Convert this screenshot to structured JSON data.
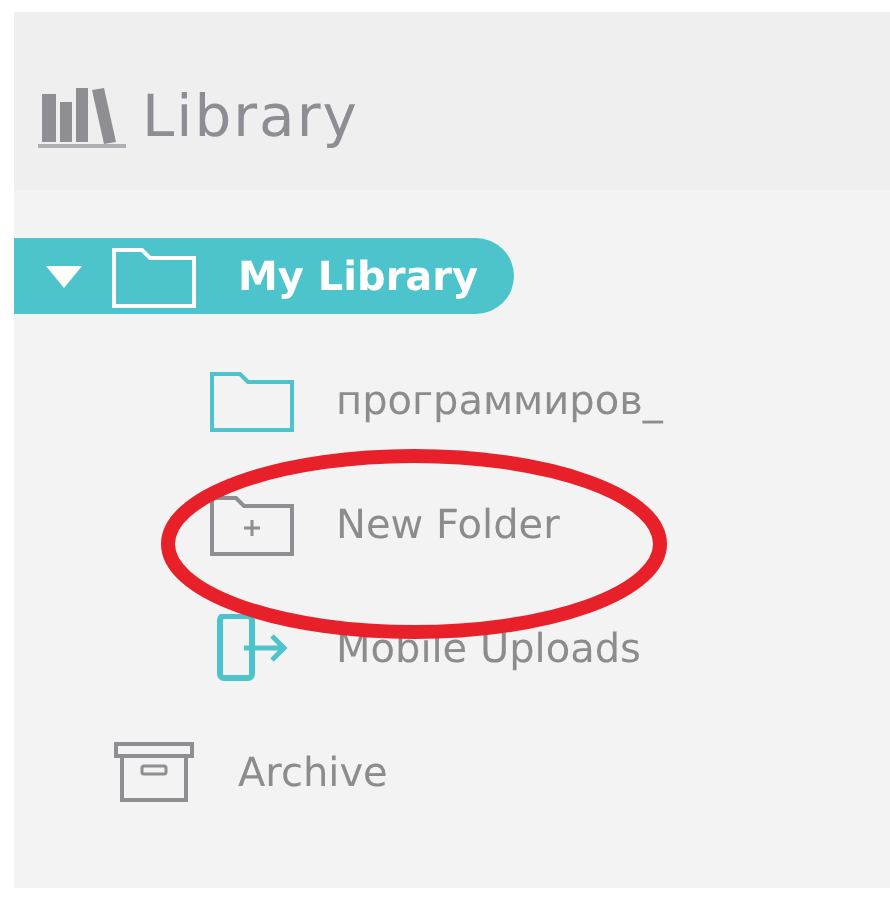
{
  "header": {
    "title": "Library"
  },
  "tree": [
    {
      "label": "My Library",
      "kind": "folder",
      "selected": true,
      "expanded": true,
      "children": [
        {
          "label": "программиров_",
          "kind": "folder",
          "selected": false
        },
        {
          "label": "New Folder",
          "kind": "new-folder",
          "selected": false
        },
        {
          "label": "Mobile Uploads",
          "kind": "mobile",
          "selected": false
        }
      ]
    },
    {
      "label": "Archive",
      "kind": "archive",
      "selected": false
    }
  ]
}
